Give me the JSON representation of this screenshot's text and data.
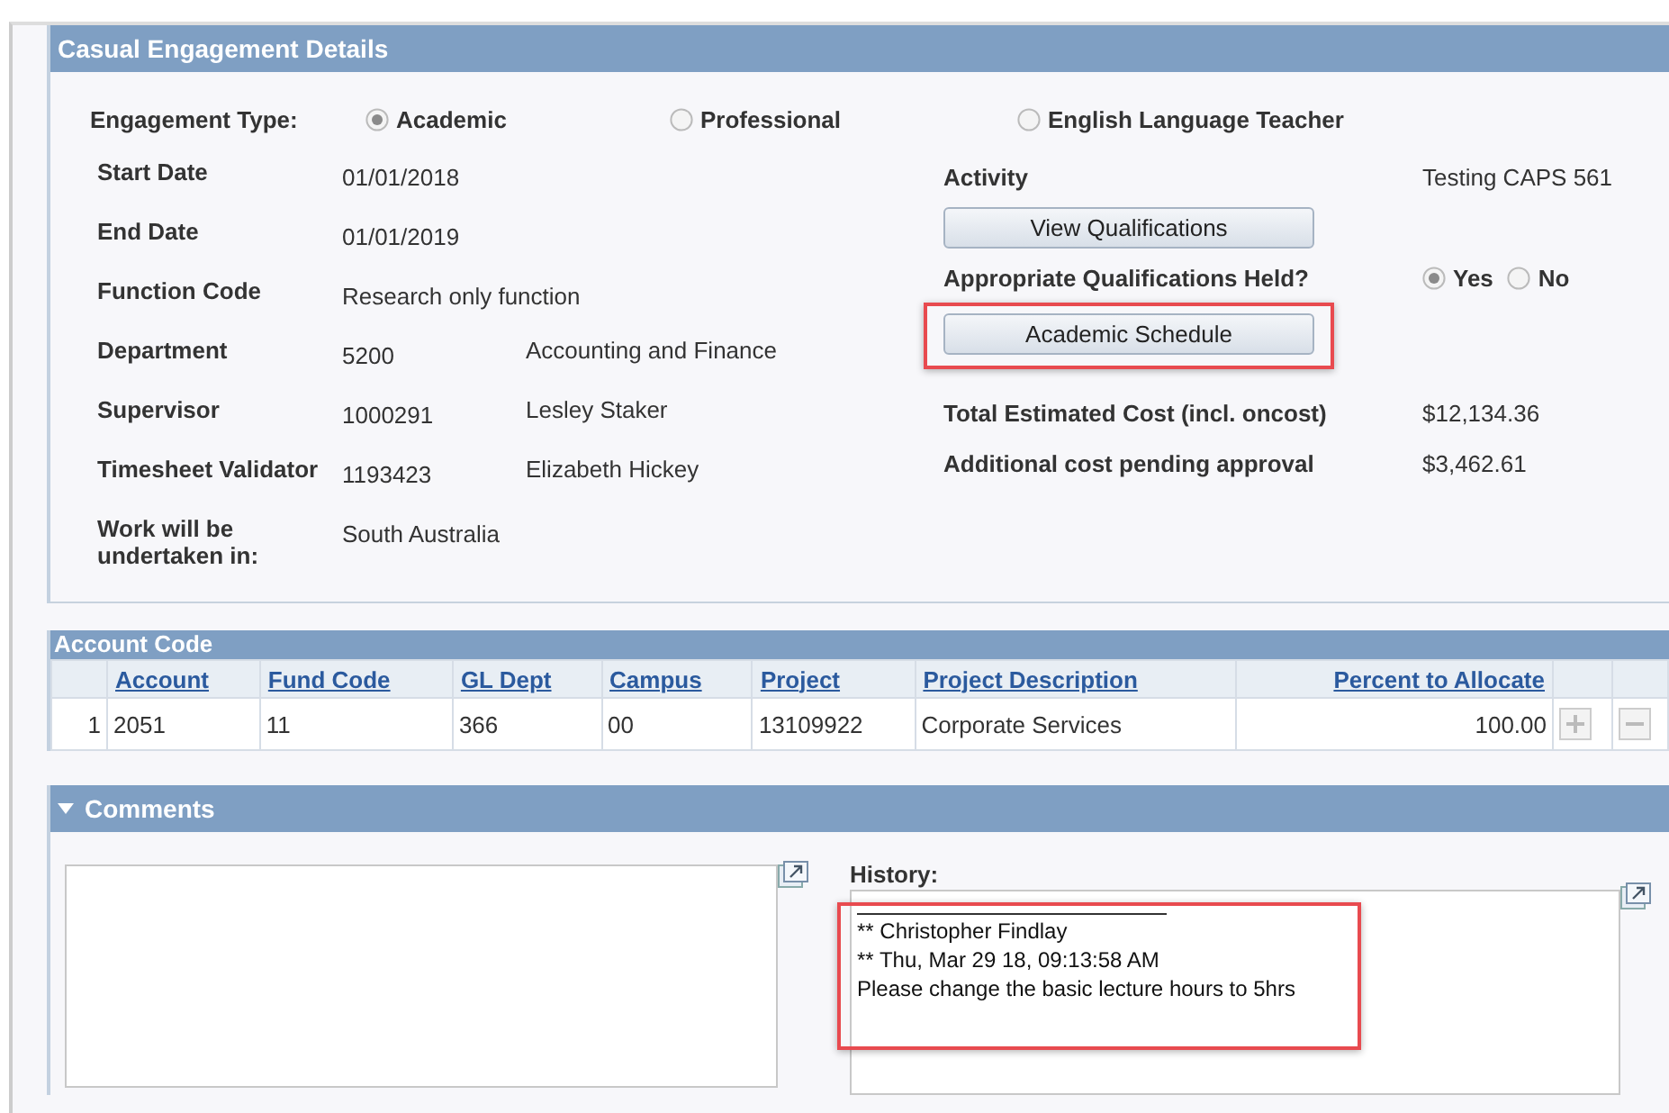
{
  "details": {
    "title": "Casual Engagement Details",
    "engagement_type": {
      "label": "Engagement Type:",
      "options": [
        {
          "label": "Academic",
          "selected": true
        },
        {
          "label": "Professional",
          "selected": false
        },
        {
          "label": "English Language Teacher",
          "selected": false
        }
      ]
    },
    "fields": [
      {
        "label": "Start Date",
        "value": "01/01/2018"
      },
      {
        "label": "End Date",
        "value": "01/01/2019"
      },
      {
        "label": "Function Code",
        "value": "Research only function"
      },
      {
        "label": "Department",
        "value": "5200",
        "description": "Accounting and Finance"
      },
      {
        "label": "Supervisor",
        "value": "1000291",
        "description": "Lesley Staker"
      },
      {
        "label": "Timesheet Validator",
        "value": "1193423",
        "description": "Elizabeth Hickey"
      },
      {
        "label": "Work will be undertaken in:",
        "value": "South Australia"
      }
    ],
    "activity": {
      "label": "Activity",
      "value": "Testing CAPS 561"
    },
    "view_button": {
      "label": "View Qualifications",
      "highlighted": false
    },
    "qualifications": {
      "label": "Appropriate Qualifications Held?",
      "options": [
        {
          "label": "Yes",
          "selected": true
        },
        {
          "label": "No",
          "selected": false
        }
      ]
    },
    "schedule_button": {
      "label": "Academic Schedule",
      "highlighted": true
    },
    "costs": [
      {
        "label": "Total Estimated Cost (incl. oncost)",
        "value": "$12,134.36"
      },
      {
        "label": "Additional cost pending approval",
        "value": "$3,462.61"
      }
    ]
  },
  "account_code": {
    "title": "Account Code",
    "columns": [
      "Account",
      "Fund Code",
      "GL Dept",
      "Campus",
      "Project",
      "Project Description",
      "Percent to Allocate"
    ],
    "rows": [
      {
        "number": "1",
        "cells": [
          "2051",
          "11",
          "366",
          "00",
          "13109922",
          "Corporate Services",
          "100.00"
        ]
      }
    ]
  },
  "comments": {
    "title": "Comments",
    "expanded": true,
    "history_label": "History:",
    "history_highlighted": true,
    "history_lines": [
      "** Christopher Findlay",
      "** Thu, Mar 29 18, 09:13:58 AM",
      "Please change the basic lecture hours to 5hrs"
    ]
  }
}
